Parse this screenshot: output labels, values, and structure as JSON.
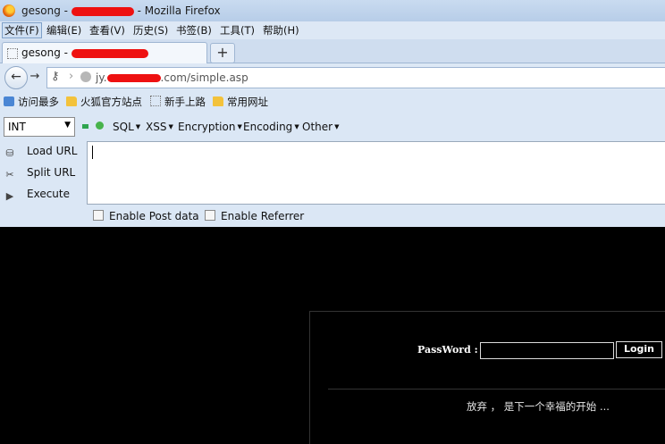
{
  "window": {
    "title_prefix": "gesong -",
    "title_suffix": "- Mozilla Firefox"
  },
  "menu": [
    {
      "label": "文件(F)"
    },
    {
      "label": "编辑(E)"
    },
    {
      "label": "查看(V)"
    },
    {
      "label": "历史(S)"
    },
    {
      "label": "书签(B)"
    },
    {
      "label": "工具(T)"
    },
    {
      "label": "帮助(H)"
    }
  ],
  "tab": {
    "label": "gesong -",
    "new_tab_symbol": "+"
  },
  "nav": {
    "url_prefix": "jy.",
    "url_suffix": ".com/simple.asp"
  },
  "bookmarks": [
    {
      "label": "访问最多",
      "icon": "blue"
    },
    {
      "label": "火狐官方站点",
      "icon": "folder"
    },
    {
      "label": "新手上路",
      "icon": "dotted"
    },
    {
      "label": "常用网址",
      "icon": "folder"
    }
  ],
  "hackbar": {
    "select_value": "INT",
    "menus": [
      {
        "label": "SQL"
      },
      {
        "label": "XSS"
      },
      {
        "label": "Encryption"
      },
      {
        "label": "Encoding"
      },
      {
        "label": "Other"
      }
    ],
    "actions": [
      {
        "label": "Load URL"
      },
      {
        "label": "Split URL"
      },
      {
        "label": "Execute"
      }
    ],
    "checkboxes": [
      {
        "label": "Enable Post data"
      },
      {
        "label": "Enable Referrer"
      }
    ]
  },
  "page": {
    "password_label": "PassWord :",
    "login_label": "Login",
    "slogan": "放弃 ， 是下一个幸福的开始 ..."
  }
}
